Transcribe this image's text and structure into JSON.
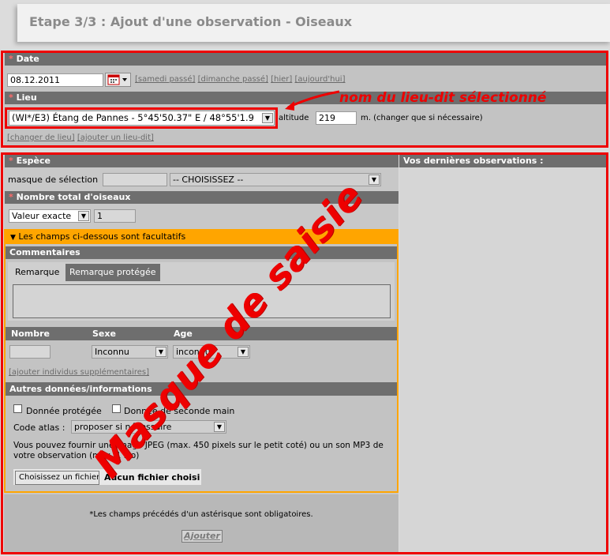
{
  "page": {
    "title": "Etape 3/3 : Ajout d'une observation - Oiseaux"
  },
  "date": {
    "label": "Date",
    "value": "08.12.2011",
    "links": [
      "[samedi passé]",
      "[dimanche passé]",
      "[hier]",
      "[aujourd'hui]"
    ]
  },
  "lieu": {
    "label": "Lieu",
    "selected": "(WI*/E3) Étang de Pannes - 5°45'50.37\" E / 48°55'1.9",
    "altitude_label": "altitude",
    "altitude_value": "219",
    "altitude_hint": "m. (changer que si nécessaire)",
    "link_change": "[changer de lieu]",
    "link_add": "[ajouter un lieu-dit]"
  },
  "annotations": {
    "lieu_note": "nom du lieu-dit sélectionné",
    "masque": "Masque de saisie"
  },
  "espece": {
    "label": "Espèce",
    "mask_label": "masque de sélection",
    "mask_value": "",
    "select_value": "-- CHOISISSEZ --"
  },
  "nombre_total": {
    "label": "Nombre total d'oiseaux",
    "type_value": "Valeur exacte",
    "count_value": "1"
  },
  "optional": {
    "header": "Les champs ci-dessous sont facultatifs",
    "comments_label": "Commentaires",
    "tabs": [
      "Remarque",
      "Remarque protégée"
    ],
    "remark_value": ""
  },
  "individus": {
    "col_nombre": "Nombre",
    "col_sexe": "Sexe",
    "col_age": "Age",
    "nombre_value": "",
    "sexe_value": "Inconnu",
    "age_value": "inconnu",
    "link_add": "[ajouter individus supplémentaires]"
  },
  "autres": {
    "label": "Autres données/informations",
    "check_protected": "Donnée protégée",
    "check_second_hand": "Donnée de seconde main",
    "atlas_label": "Code atlas :",
    "atlas_value": "proposer si nécessaire",
    "file_hint": "Vous pouvez fournir une image JPEG (max. 450 pixels sur le petit coté) ou un son MP3 de votre observation (max. 1 Mo)",
    "file_button": "Choisissez un fichier",
    "file_status": "Aucun fichier choisi"
  },
  "footer": {
    "note": "*Les champs précédés d'un astérisque sont obligatoires.",
    "submit": "Ajouter"
  },
  "sidebar": {
    "title": "Vos dernières observations :"
  },
  "colors": {
    "highlight_red": "#ee0000",
    "optional_orange": "#ffa500",
    "header_gray": "#6e6e6e"
  }
}
